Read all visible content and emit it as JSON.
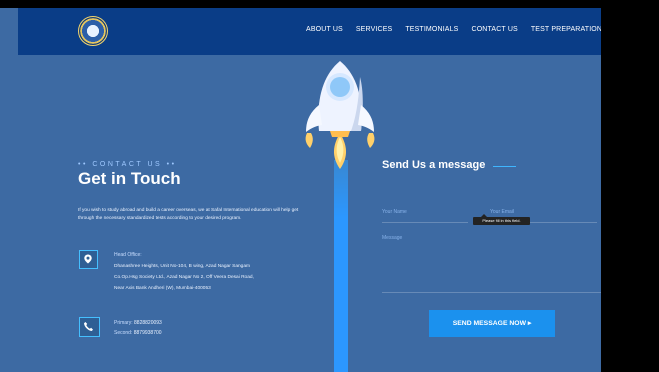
{
  "navbar": {
    "menu": [
      "ABOUT US",
      "SERVICES",
      "TESTIMONIALS",
      "CONTACT US",
      "TEST PREPARATION"
    ]
  },
  "contact": {
    "label": "•• CONTACT US ••",
    "title": "Get in Touch",
    "intro": "If you wish to study abroad and build a career overseas, we at Safal International education will help get through the necessary standardized tests according to your desired program.",
    "office_label": "Head Office:",
    "address_lines": [
      "Dhanashree Heights, Unit No-104, B wing, Azad Nagar Sangam",
      "Co.Op.Hsg Society Ltd., Azad Nagar No 2, Off Veera Desai Road,",
      "Near Axis Bank Andheri (W), Mumbai-400053"
    ],
    "phone_primary_label": "Primary:",
    "phone_primary": "8828820093",
    "phone_secondary_label": "Second:",
    "phone_secondary": "8879938700"
  },
  "form": {
    "title": "Send Us a message",
    "name_placeholder": "Your Name",
    "email_placeholder": "Your Email",
    "message_placeholder": "Message",
    "tooltip": "Please fill in this field.",
    "submit": "SEND MESSAGE NOW ▸"
  },
  "colors": {
    "background": "#3d6aa3",
    "navbar": "#0a3d87",
    "accent": "#2c97ff"
  },
  "icons": {
    "logo": "school-emblem-logo",
    "office": "location-pin-icon",
    "phone": "phone-icon",
    "hero": "rocket-icon"
  }
}
